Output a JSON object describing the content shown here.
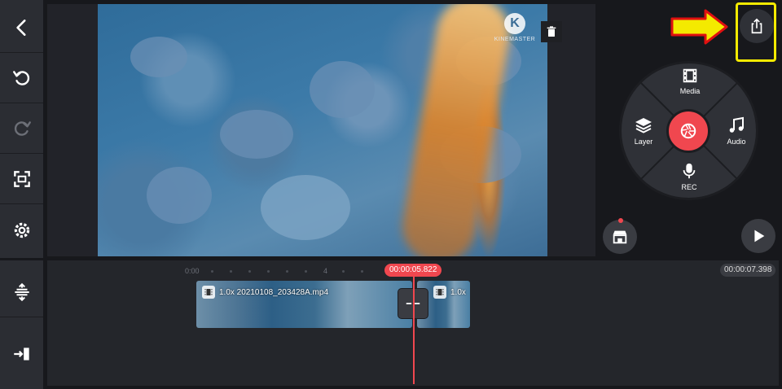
{
  "left_toolbar": {
    "items": [
      {
        "icon": "back-icon"
      },
      {
        "icon": "undo-icon"
      },
      {
        "icon": "redo-icon"
      },
      {
        "icon": "fullscreen-icon"
      },
      {
        "icon": "settings-icon"
      }
    ],
    "lower_items": [
      {
        "icon": "timeline-expand-icon"
      },
      {
        "icon": "jump-to-end-icon"
      }
    ]
  },
  "preview": {
    "watermark_text": "KINEMASTER",
    "watermark_letter": "K"
  },
  "media_wheel": {
    "media_label": "Media",
    "layer_label": "Layer",
    "audio_label": "Audio",
    "rec_label": "REC"
  },
  "timeline": {
    "ruler_start": "0:00",
    "ruler_mid": "4",
    "current_time": "00:00:05.822",
    "total_time": "00:00:07.398",
    "clips": [
      {
        "label": "1.0x 20210108_203428A.mp4"
      },
      {
        "label": "1.0x"
      }
    ]
  },
  "colors": {
    "accent": "#f0474f",
    "highlight": "#f4ea00",
    "panel": "#2b2d33"
  }
}
